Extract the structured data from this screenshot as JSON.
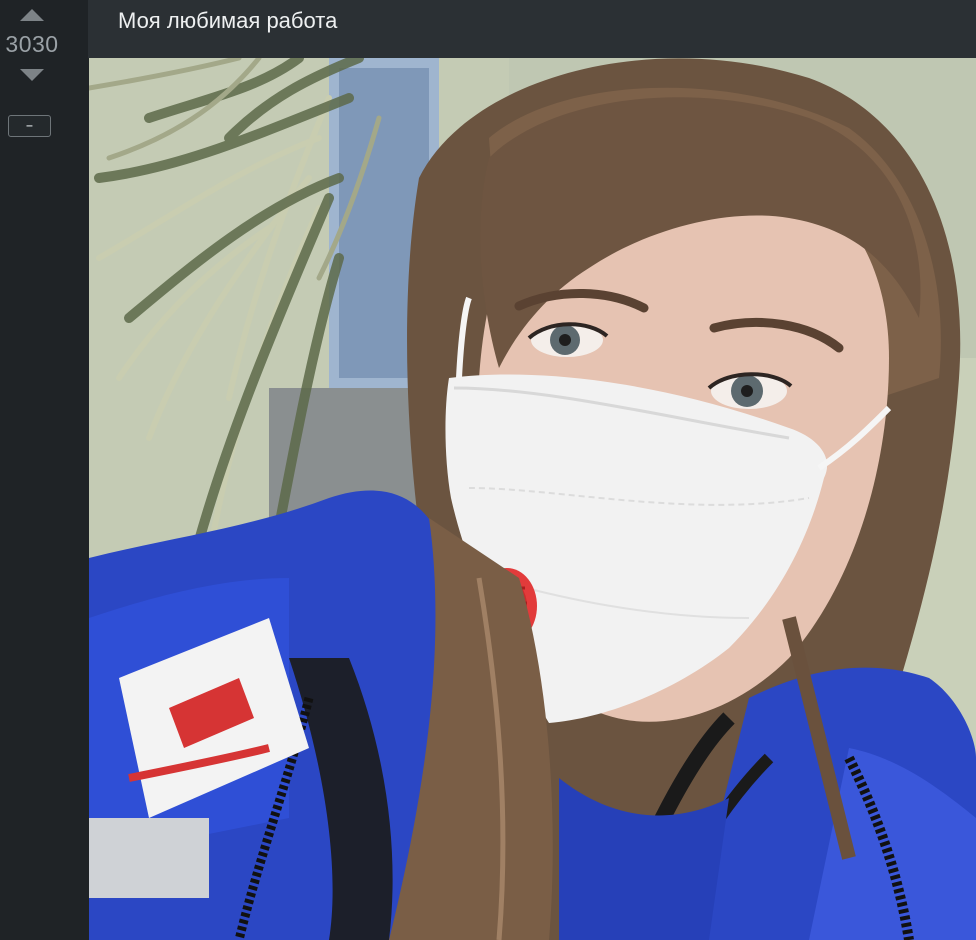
{
  "vote": {
    "score": "3030",
    "collapse_label": "–"
  },
  "post": {
    "title": "Моя любимая работа"
  },
  "photo": {
    "subject": "selfie",
    "accent_jacket": "#2b47c4",
    "mask_color": "#f2f2f2",
    "valve_color": "#e23b3b"
  }
}
